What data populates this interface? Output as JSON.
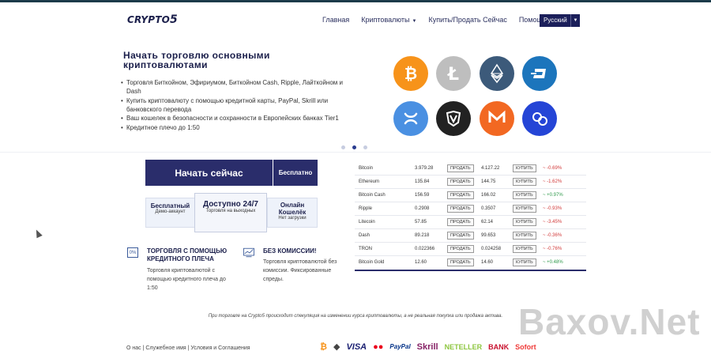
{
  "brand": {
    "logo_main": "CRYPTO",
    "logo_num": "5"
  },
  "nav": {
    "items": [
      "Главная",
      "Криптовалюты",
      "Купить/Продать Сейчас",
      "Помощь"
    ],
    "language": "Русский"
  },
  "hero": {
    "title": "Начать торговлю основными криптовалютами",
    "bullets": [
      "Торговля Биткойном, Эфириумом, Биткойном Cash, Ripple, Лайткойном и Dash",
      "Купить криптовалюту с помощью кредитной карты, PayPal, Skrill или банковского перевода",
      "Ваш кошелек в безопасности и сохранности в Европейских банках Tier1",
      "Кредитное плечо до 1:50"
    ],
    "coins": [
      {
        "icon": "bitcoin-icon",
        "color": "#f7931a"
      },
      {
        "icon": "litecoin-icon",
        "color": "#bebebe"
      },
      {
        "icon": "ethereum-icon",
        "color": "#3c5a7a"
      },
      {
        "icon": "dash-icon",
        "color": "#1c75bc"
      },
      {
        "icon": "ripple-icon",
        "color": "#4a90e2"
      },
      {
        "icon": "nem-icon",
        "color": "#222222"
      },
      {
        "icon": "monero-icon",
        "color": "#f26822"
      },
      {
        "icon": "gridcoin-icon",
        "color": "#2545d6"
      }
    ]
  },
  "cta": {
    "start_label": "Начать сейчас",
    "free_label": "Бесплатно",
    "tiles": [
      {
        "title": "Бесплатный",
        "sub": "Демо-аккаунт"
      },
      {
        "title": "Доступно 24/7",
        "sub": "Торговля на выходных"
      },
      {
        "title": "Онлайн Кошелёк",
        "sub": "Нет загрузки"
      }
    ]
  },
  "features": [
    {
      "icon": "percent-icon",
      "icon_text": "0%",
      "title": "ТОРГОВЛЯ С ПОМОЩЬЮ КРЕДИТНОГО ПЛЕЧА",
      "text": "Торговля криптовалютой с помощью кредитного плеча до 1:50"
    },
    {
      "icon": "chart-icon",
      "icon_text": "",
      "title": "БЕЗ КОМИССИИ!",
      "text": "Торговля криптовалютой без комиссии. Фиксированные спреды."
    }
  ],
  "prices": {
    "sell_label": "ПРОДАТЬ",
    "buy_label": "КУПИТЬ",
    "rows": [
      {
        "name": "Bitcoin",
        "sell": "3.979.28",
        "buy": "4.127.22",
        "change": "~ -0.69%",
        "dir": "down"
      },
      {
        "name": "Ethereum",
        "sell": "135.84",
        "buy": "144.75",
        "change": "~ -1.62%",
        "dir": "down"
      },
      {
        "name": "Bitcoin Cash",
        "sell": "156.59",
        "buy": "166.02",
        "change": "~ +0.97%",
        "dir": "up"
      },
      {
        "name": "Ripple",
        "sell": "0.2908",
        "buy": "0.3507",
        "change": "~ -0.93%",
        "dir": "down"
      },
      {
        "name": "Litecoin",
        "sell": "57.85",
        "buy": "62.14",
        "change": "~ -3.45%",
        "dir": "down"
      },
      {
        "name": "Dash",
        "sell": "89.218",
        "buy": "99.653",
        "change": "~ -0.36%",
        "dir": "down"
      },
      {
        "name": "TRON",
        "sell": "0.022366",
        "buy": "0.024258",
        "change": "~ -0.76%",
        "dir": "down"
      },
      {
        "name": "Bitcoin Gold",
        "sell": "12.60",
        "buy": "14.60",
        "change": "~ +0.48%",
        "dir": "up"
      }
    ]
  },
  "disclaimer": "При торговле на Crypto5 происходит спекуляция на изменении курса криптовалюты, а не реальная покупка или продажа актива.",
  "footer": {
    "links": "О нас | Служебное имя | Условия и Соглашения",
    "payments": [
      {
        "label": "₿",
        "color": "#f7931a"
      },
      {
        "label": "◆",
        "color": "#444444"
      },
      {
        "label": "VISA",
        "color": "#1a1f71"
      },
      {
        "label": "●●",
        "color": "#eb001b"
      },
      {
        "label": "PayPal",
        "color": "#003087"
      },
      {
        "label": "Skrill",
        "color": "#862165"
      },
      {
        "label": "NETELLER",
        "color": "#8dc63f"
      },
      {
        "label": "BANK",
        "color": "#c8102e"
      },
      {
        "label": "Sofort",
        "color": "#ef3b39"
      }
    ]
  },
  "watermark": "Baxov.Net"
}
